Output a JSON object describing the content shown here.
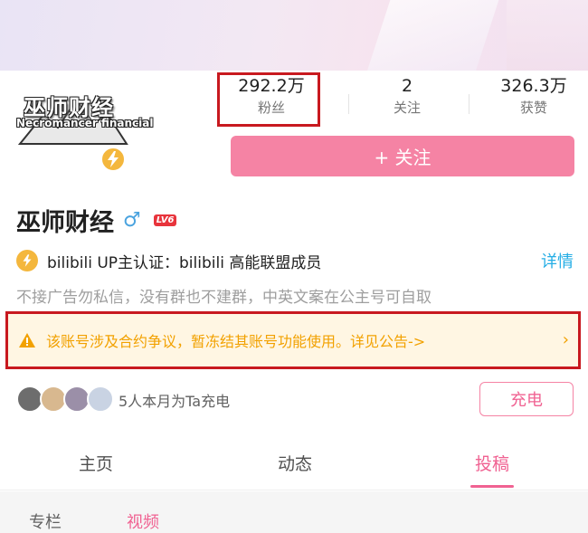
{
  "profile": {
    "avatar_title": "巫师财经",
    "avatar_subtitle": "Necromancer financial",
    "name": "巫师财经",
    "gender_symbol": "♂",
    "level": "LV6"
  },
  "stats": {
    "fans_value": "292.2万",
    "fans_label": "粉丝",
    "following_value": "2",
    "following_label": "关注",
    "likes_value": "326.3万",
    "likes_label": "获赞"
  },
  "follow_button": {
    "label": "+ 关注"
  },
  "certification": {
    "text": "bilibili  UP主认证：bilibili  高能联盟成员",
    "detail_label": "详情"
  },
  "bio": "不接广告勿私信，没有群也不建群，中英文案在公主号可自取",
  "notice": {
    "text": "该账号涉及合约争议，暂冻结其账号功能使用。详见公告->",
    "chevron": "›"
  },
  "charge": {
    "text": "5人本月为Ta充电",
    "button_label": "充电"
  },
  "tabs": [
    {
      "label": "主页",
      "active": false
    },
    {
      "label": "动态",
      "active": false
    },
    {
      "label": "投稿",
      "active": true
    }
  ],
  "subtabs": [
    {
      "label": "专栏",
      "active": false
    },
    {
      "label": "视频",
      "active": true
    }
  ],
  "colors": {
    "accent_pink": "#f583a4",
    "highlight_red": "#c8191f",
    "notice_bg": "#fff6e3",
    "notice_text": "#f2a100",
    "link_blue": "#23ade5"
  }
}
